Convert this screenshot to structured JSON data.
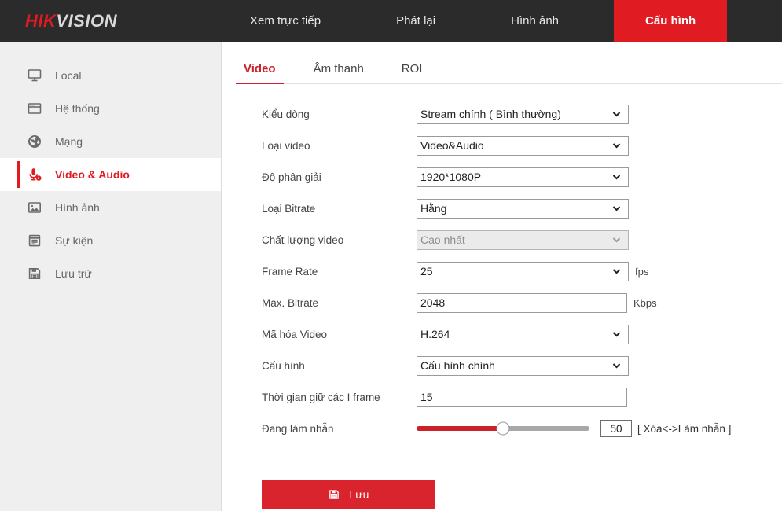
{
  "brand": {
    "part1": "HIK",
    "part2": "VISION"
  },
  "nav": {
    "items": [
      {
        "label": "Xem trực tiếp",
        "active": false
      },
      {
        "label": "Phát lại",
        "active": false
      },
      {
        "label": "Hình ảnh",
        "active": false
      },
      {
        "label": "Cấu hình",
        "active": true
      }
    ]
  },
  "sidebar": {
    "items": [
      {
        "label": "Local",
        "icon": "monitor-icon",
        "active": false
      },
      {
        "label": "Hệ thống",
        "icon": "window-icon",
        "active": false
      },
      {
        "label": "Mạng",
        "icon": "globe-icon",
        "active": false
      },
      {
        "label": "Video & Audio",
        "icon": "microphone-icon",
        "active": true
      },
      {
        "label": "Hình ảnh",
        "icon": "picture-icon",
        "active": false
      },
      {
        "label": "Sự kiện",
        "icon": "calendar-icon",
        "active": false
      },
      {
        "label": "Lưu trữ",
        "icon": "floppy-disk-icon",
        "active": false
      }
    ]
  },
  "tabs": [
    {
      "label": "Video",
      "active": true
    },
    {
      "label": "Âm thanh",
      "active": false
    },
    {
      "label": "ROI",
      "active": false
    }
  ],
  "form": {
    "stream_type": {
      "label": "Kiểu dòng",
      "value": "Stream chính ( Bình thường)"
    },
    "video_type": {
      "label": "Loại video",
      "value": "Video&Audio"
    },
    "resolution": {
      "label": "Độ phân giải",
      "value": "1920*1080P"
    },
    "bitrate_type": {
      "label": "Loại Bitrate",
      "value": "Hằng"
    },
    "video_quality": {
      "label": "Chất lượng video",
      "value": "Cao nhất",
      "disabled": true
    },
    "frame_rate": {
      "label": "Frame Rate",
      "value": "25",
      "unit": "fps"
    },
    "max_bitrate": {
      "label": "Max. Bitrate",
      "value": "2048",
      "unit": "Kbps"
    },
    "video_encoding": {
      "label": "Mã hóa Video",
      "value": "H.264"
    },
    "profile": {
      "label": "Cấu hình",
      "value": "Cấu hình chính"
    },
    "i_frame_interval": {
      "label": "Thời gian giữ các I frame",
      "value": "15"
    },
    "smoothing": {
      "label": "Đang làm nhẵn",
      "value": "50",
      "percent": 50,
      "hint": "[ Xóa<->Làm nhẵn ]"
    }
  },
  "save": {
    "label": "Lưu",
    "icon": "floppy-disk-icon"
  },
  "colors": {
    "brand_red": "#e11b22",
    "header_bg": "#2b2b2b",
    "sidebar_bg": "#efefef",
    "slider_fill": "#cc2229",
    "save_bg": "#d9232d"
  }
}
